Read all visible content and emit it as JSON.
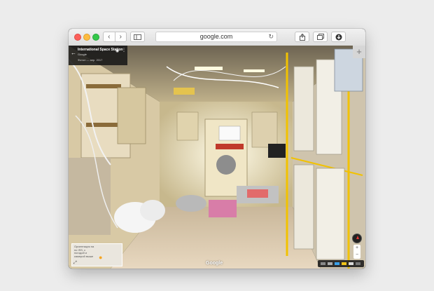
{
  "browser": {
    "address": "google.com",
    "back_icon": "chevron-left-icon",
    "forward_icon": "chevron-right-icon",
    "reload_icon": "reload-icon",
    "newtab_label": "+"
  },
  "place_card": {
    "title": "International Space Station",
    "subtitle": "Google",
    "date": "Фотон — апр. 2017"
  },
  "minimap": {
    "text": [
      "Ориентация на",
      "по ISS, с",
      "погодой и",
      "камерой выше"
    ]
  },
  "attribution": "Google",
  "colors": {
    "traffic_red": "#fc605b",
    "traffic_yellow": "#fdbc40",
    "traffic_green": "#34c84a"
  }
}
